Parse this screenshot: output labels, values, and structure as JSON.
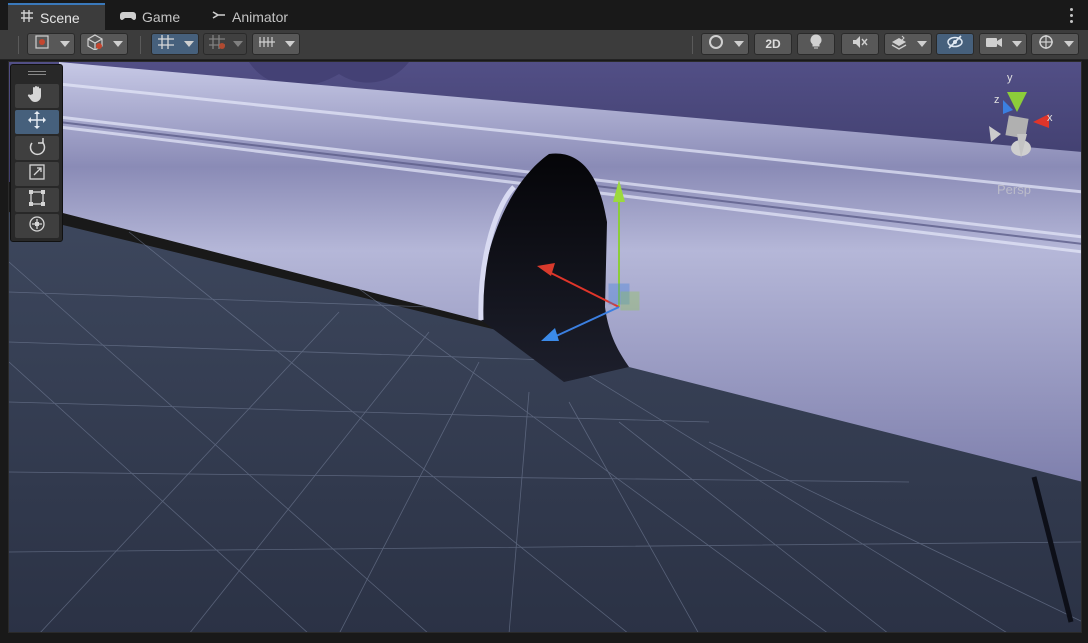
{
  "tabs": [
    {
      "label": "Scene",
      "icon": "grid-hash-icon",
      "active": true
    },
    {
      "label": "Game",
      "icon": "gamepad-icon",
      "active": false
    },
    {
      "label": "Animator",
      "icon": "animator-icon",
      "active": false
    }
  ],
  "toolbar": {
    "toggle_2d_label": "2D"
  },
  "tools": [
    "hand-tool",
    "move-tool",
    "rotate-tool",
    "scale-tool",
    "rect-tool",
    "transform-tool"
  ],
  "gizmo": {
    "x_label": "x",
    "y_label": "y",
    "z_label": "z",
    "projection_label": "Persp"
  },
  "colors": {
    "accent": "#46607c",
    "x_axis": "#e0352a",
    "y_axis": "#8ccd3a",
    "z_axis": "#3b7fe0"
  }
}
